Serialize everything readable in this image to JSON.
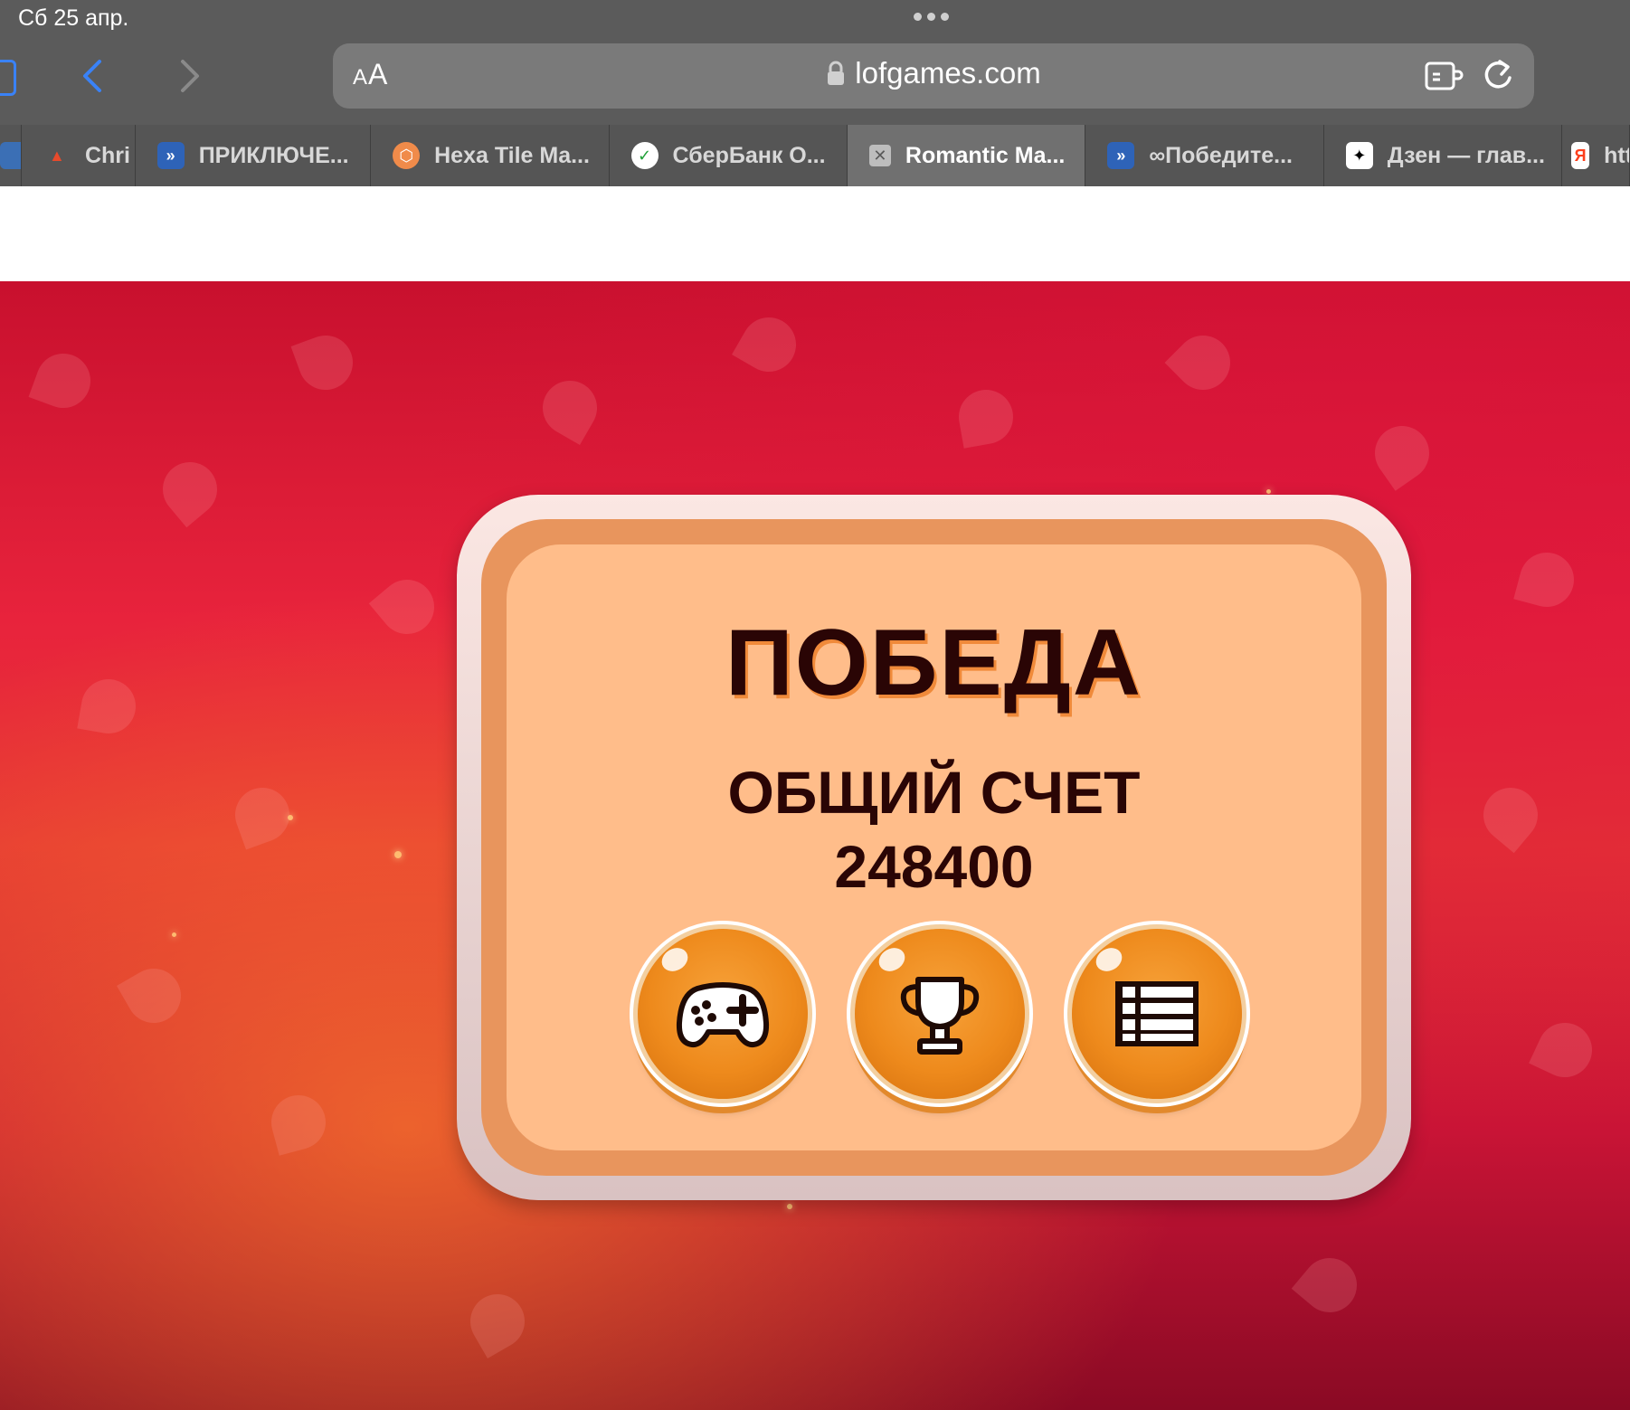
{
  "status_bar": {
    "time": "Сб 25 апр."
  },
  "browser": {
    "reader_label": "AA",
    "url": "lofgames.com",
    "icons": {
      "sidebar": "sidebar-icon",
      "back": "chevron-left-icon",
      "forward": "chevron-right-icon",
      "lock": "lock-icon",
      "extension": "extension-icon",
      "reload": "reload-icon"
    },
    "accent_color": "#3a82f7"
  },
  "tabs": [
    {
      "label": "Chri",
      "favicon": "christmas-icon",
      "active": false
    },
    {
      "label": "ПРИКЛЮЧЕ...",
      "favicon": "game-icon",
      "active": false
    },
    {
      "label": "Hexa Tile Ma...",
      "favicon": "hexa-icon",
      "active": false
    },
    {
      "label": "СберБанк О...",
      "favicon": "sber-icon",
      "active": false
    },
    {
      "label": "Romantic Ma...",
      "favicon": "close-icon",
      "active": true
    },
    {
      "label": "∞Победите...",
      "favicon": "game-icon",
      "active": false
    },
    {
      "label": "Дзен — глав...",
      "favicon": "zen-icon",
      "active": false
    },
    {
      "label": "htt",
      "favicon": "yandex-icon",
      "active": false
    }
  ],
  "dialog": {
    "title": "ПОБЕДА",
    "score_label": "ОБЩИЙ СЧЕТ",
    "score_value": "248400",
    "buttons": [
      {
        "name": "play-again",
        "icon": "gamepad-icon"
      },
      {
        "name": "leaderboard",
        "icon": "trophy-icon"
      },
      {
        "name": "level-list",
        "icon": "list-icon"
      }
    ]
  }
}
